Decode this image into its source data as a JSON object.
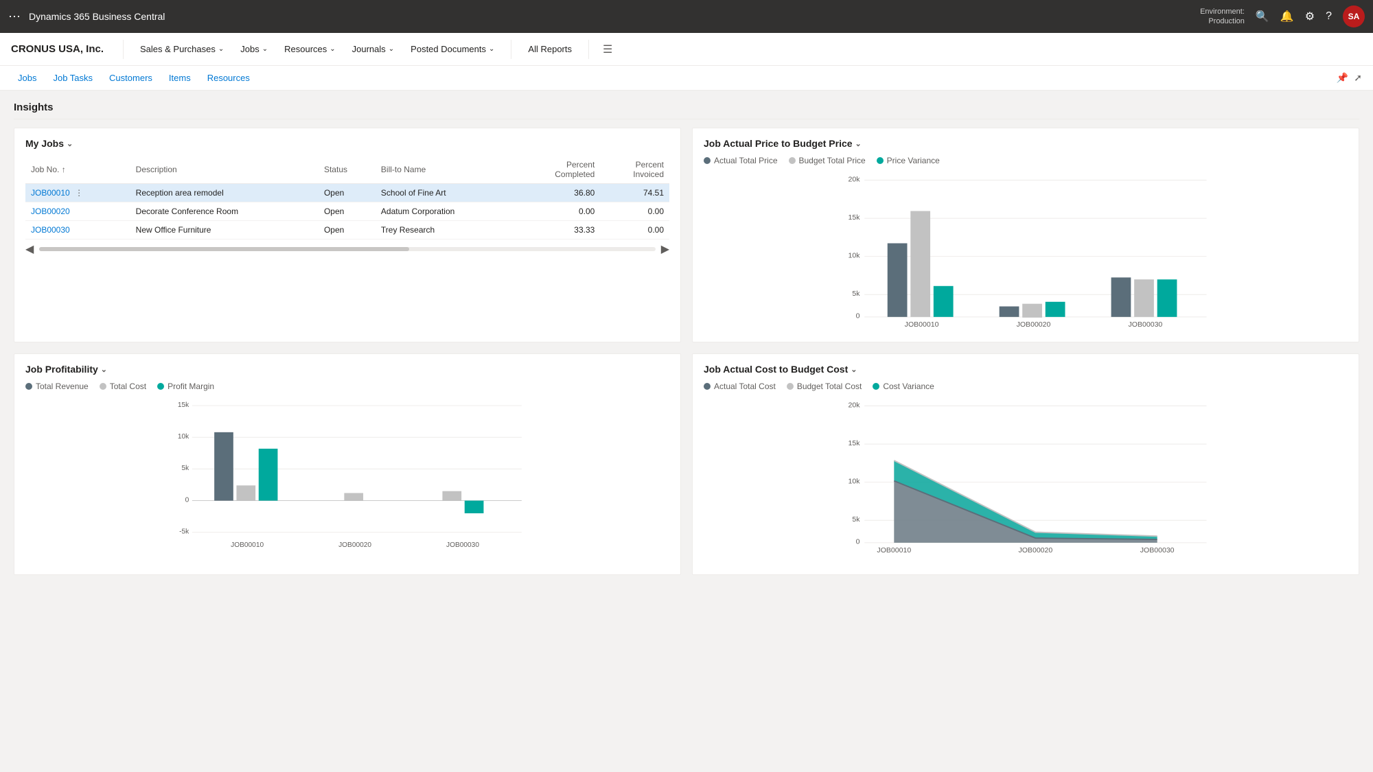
{
  "topbar": {
    "app_name": "Dynamics 365 Business Central",
    "env_label": "Environment:",
    "env_name": "Production",
    "avatar_initials": "SA"
  },
  "secondnav": {
    "company": "CRONUS USA, Inc.",
    "items": [
      {
        "label": "Sales & Purchases",
        "has_chevron": true
      },
      {
        "label": "Jobs",
        "has_chevron": true
      },
      {
        "label": "Resources",
        "has_chevron": true
      },
      {
        "label": "Journals",
        "has_chevron": true
      },
      {
        "label": "Posted Documents",
        "has_chevron": true
      }
    ],
    "all_reports": "All Reports"
  },
  "subnav": {
    "items": [
      "Jobs",
      "Job Tasks",
      "Customers",
      "Items",
      "Resources"
    ]
  },
  "insights": {
    "title": "Insights",
    "my_jobs": {
      "title": "My Jobs",
      "columns": [
        "Job No. ↑",
        "Description",
        "Status",
        "Bill-to Name",
        "Percent Completed",
        "Percent Invoiced"
      ],
      "rows": [
        {
          "job_no": "JOB00010",
          "description": "Reception area remodel",
          "status": "Open",
          "bill_to": "School of Fine Art",
          "pct_completed": "36.80",
          "pct_invoiced": "74.51",
          "selected": true
        },
        {
          "job_no": "JOB00020",
          "description": "Decorate Conference Room",
          "status": "Open",
          "bill_to": "Adatum Corporation",
          "pct_completed": "0.00",
          "pct_invoiced": "0.00",
          "selected": false
        },
        {
          "job_no": "JOB00030",
          "description": "New Office Furniture",
          "status": "Open",
          "bill_to": "Trey Research",
          "pct_completed": "33.33",
          "pct_invoiced": "0.00",
          "selected": false
        }
      ]
    },
    "price_chart": {
      "title": "Job Actual Price to Budget Price",
      "legend": [
        {
          "label": "Actual Total Price",
          "color": "#5b6e7a"
        },
        {
          "label": "Budget Total Price",
          "color": "#c2c2c2"
        },
        {
          "label": "Price Variance",
          "color": "#00a99d"
        }
      ],
      "y_labels": [
        "20k",
        "15k",
        "10k",
        "5k",
        "0"
      ],
      "x_labels": [
        "JOB00010",
        "JOB00020",
        "JOB00030"
      ],
      "bars": {
        "JOB00010": {
          "actual": 10800,
          "budget": 15500,
          "variance": 4500
        },
        "JOB00020": {
          "actual": 1600,
          "budget": 2000,
          "variance": 2200
        },
        "JOB00030": {
          "actual": 5800,
          "budget": 5500,
          "variance": 5500
        }
      },
      "max": 20000
    },
    "profitability_chart": {
      "title": "Job Profitability",
      "legend": [
        {
          "label": "Total Revenue",
          "color": "#5b6e7a"
        },
        {
          "label": "Total Cost",
          "color": "#c2c2c2"
        },
        {
          "label": "Profit Margin",
          "color": "#00a99d"
        }
      ],
      "y_labels": [
        "15k",
        "10k",
        "5k",
        "0",
        "-5k"
      ],
      "x_labels": [
        "JOB00010",
        "JOB00020",
        "JOB00030"
      ],
      "bars": {
        "JOB00010": {
          "revenue": 10800,
          "cost": 2400,
          "margin": 8200
        },
        "JOB00020": {
          "revenue": 0,
          "cost": 1200,
          "margin": -900
        },
        "JOB00030": {
          "revenue": 0,
          "cost": 1500,
          "margin": -2000
        }
      },
      "max": 15000,
      "min": -5000
    },
    "cost_chart": {
      "title": "Job Actual Cost to Budget Cost",
      "legend": [
        {
          "label": "Actual Total Cost",
          "color": "#5b6e7a"
        },
        {
          "label": "Budget Total Cost",
          "color": "#c2c2c2"
        },
        {
          "label": "Cost Variance",
          "color": "#00a99d"
        }
      ],
      "y_labels": [
        "20k",
        "15k",
        "10k",
        "5k",
        "0"
      ],
      "x_labels": [
        "JOB00010",
        "JOB00020",
        "JOB00030"
      ]
    }
  }
}
